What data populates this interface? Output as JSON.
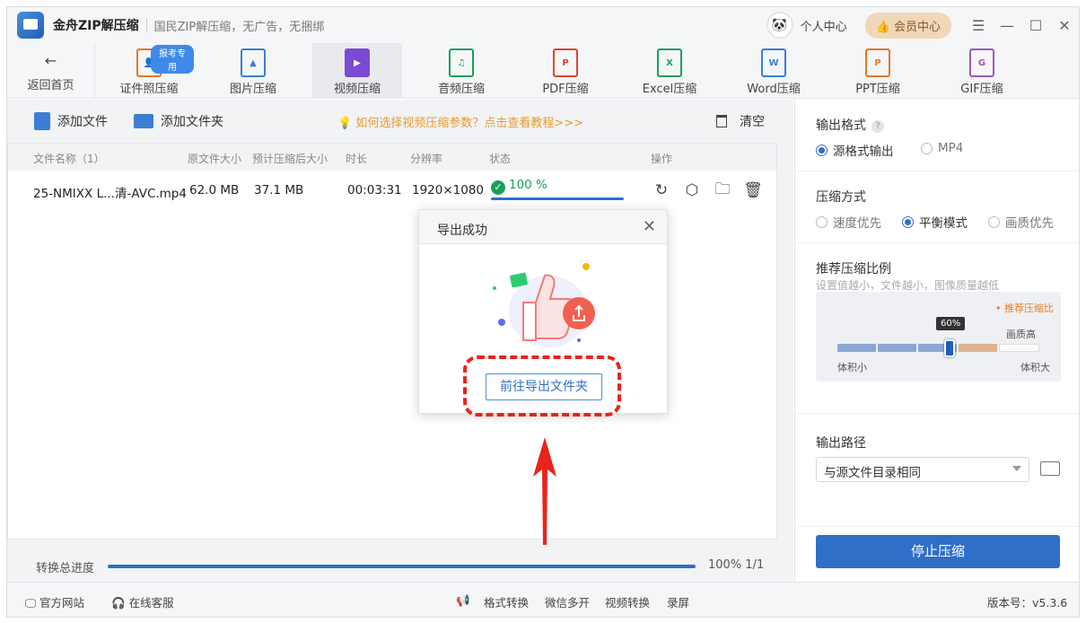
{
  "app": {
    "name": "金舟ZIP解压缩",
    "slogan": "国民ZIP解压缩，无广告，无捆绑",
    "user_center": "个人中心",
    "member_center": "会员中心"
  },
  "toolbar": {
    "back_label": "返回首页",
    "badge": "报考专用",
    "tools": [
      {
        "label": "证件照压缩",
        "icon": "id-photo-icon",
        "color": "#e07a2a"
      },
      {
        "label": "图片压缩",
        "icon": "image-file-icon",
        "color": "#3a7fd5"
      },
      {
        "label": "视频压缩",
        "icon": "video-file-icon",
        "color": "#7b4ad6"
      },
      {
        "label": "音频压缩",
        "icon": "audio-file-icon",
        "color": "#1aa05a"
      },
      {
        "label": "PDF压缩",
        "icon": "pdf-file-icon",
        "color": "#e0452f"
      },
      {
        "label": "Excel压缩",
        "icon": "excel-file-icon",
        "color": "#1aa05a"
      },
      {
        "label": "Word压缩",
        "icon": "word-file-icon",
        "color": "#3a7fd5"
      },
      {
        "label": "PPT压缩",
        "icon": "ppt-file-icon",
        "color": "#e07a2a"
      },
      {
        "label": "GIF压缩",
        "icon": "gif-file-icon",
        "color": "#9b59b6"
      }
    ]
  },
  "actions": {
    "add_file": "添加文件",
    "add_folder": "添加文件夹",
    "tip": "如何选择视频压缩参数？点击查看教程>>>",
    "clear": "清空"
  },
  "table": {
    "headers": [
      "文件名称（1）",
      "原文件大小",
      "预计压缩后大小",
      "时长",
      "分辨率",
      "状态",
      "操作"
    ],
    "rows": [
      {
        "name": "25-NMIXX L...清-AVC.mp4",
        "orig_size": "62.0 MB",
        "est_size": "37.1 MB",
        "duration": "00:03:31",
        "resolution": "1920×1080",
        "status": "100 %",
        "progress": 1.0
      }
    ]
  },
  "progress": {
    "label": "转换总进度",
    "text": "100% 1/1",
    "value": 1.0
  },
  "settings": {
    "output_format": {
      "title": "输出格式",
      "options": [
        "源格式输出",
        "MP4"
      ],
      "selected": "源格式输出"
    },
    "compress_mode": {
      "title": "压缩方式",
      "options": [
        "速度优先",
        "平衡模式",
        "画质优先"
      ],
      "selected": "平衡模式"
    },
    "ratio": {
      "title": "推荐压缩比例",
      "hint": "设置值越小，文件越小，图像质量越低",
      "recommend": "• 推荐压缩比",
      "quality_high": "画质高",
      "value_label": "60%",
      "value": 0.6,
      "small": "体积小",
      "big": "体积大"
    },
    "output_path": {
      "title": "输出路径",
      "value": "与源文件目录相同"
    },
    "stop_button": "停止压缩"
  },
  "footer": {
    "website": "官方网站",
    "service": "在线客服",
    "links": [
      "格式转换",
      "微信多开",
      "视频转换",
      "录屏"
    ],
    "version": "版本号：v5.3.6"
  },
  "modal": {
    "title": "导出成功",
    "button": "前往导出文件夹"
  }
}
